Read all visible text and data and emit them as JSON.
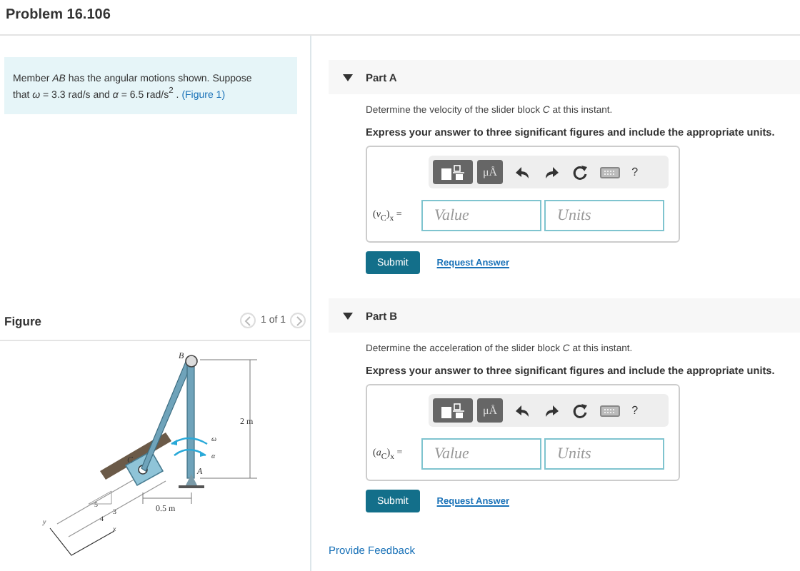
{
  "page_title": "Problem 16.106",
  "problem": {
    "text": "Member *AB* has the angular motions shown. Suppose that *ω* = 3.3  rad/s and *α* = 6.5  rad/s$^{2}$ . ",
    "link": "(Figure 1)"
  },
  "figure": {
    "title": "Figure",
    "pager": "1 of 1",
    "labels": {
      "b": "B",
      "c": "C",
      "a": "A",
      "omega": "ω",
      "alpha": "α",
      "height": "2 m",
      "offset": "0.5 m",
      "hyp": "5",
      "rise": "3",
      "run": "4",
      "x": "x",
      "y": "y"
    }
  },
  "parts": [
    {
      "title": "Part A",
      "expanded": true,
      "question": "Determine the velocity of the slider block *C* at this instant.",
      "instruction": "Express your answer to three significant figures and include the appropriate units.",
      "units_button": "μÅ",
      "help": "?",
      "answer_label": "(*v*$_{C}$)$_{x}$ =",
      "value_placeholder": "Value",
      "units_placeholder": "Units",
      "submit": "Submit",
      "request": "Request Answer"
    },
    {
      "title": "Part B",
      "expanded": true,
      "question": "Determine the acceleration of the slider block *C* at this instant.",
      "instruction": "Express your answer to three significant figures and include the appropriate units.",
      "units_button": "μÅ",
      "help": "?",
      "answer_label": "(*a*$_{C}$)$_{x}$ =",
      "value_placeholder": "Value",
      "units_placeholder": "Units",
      "submit": "Submit",
      "request": "Request Answer"
    }
  ],
  "feedback_link": "Provide Feedback"
}
